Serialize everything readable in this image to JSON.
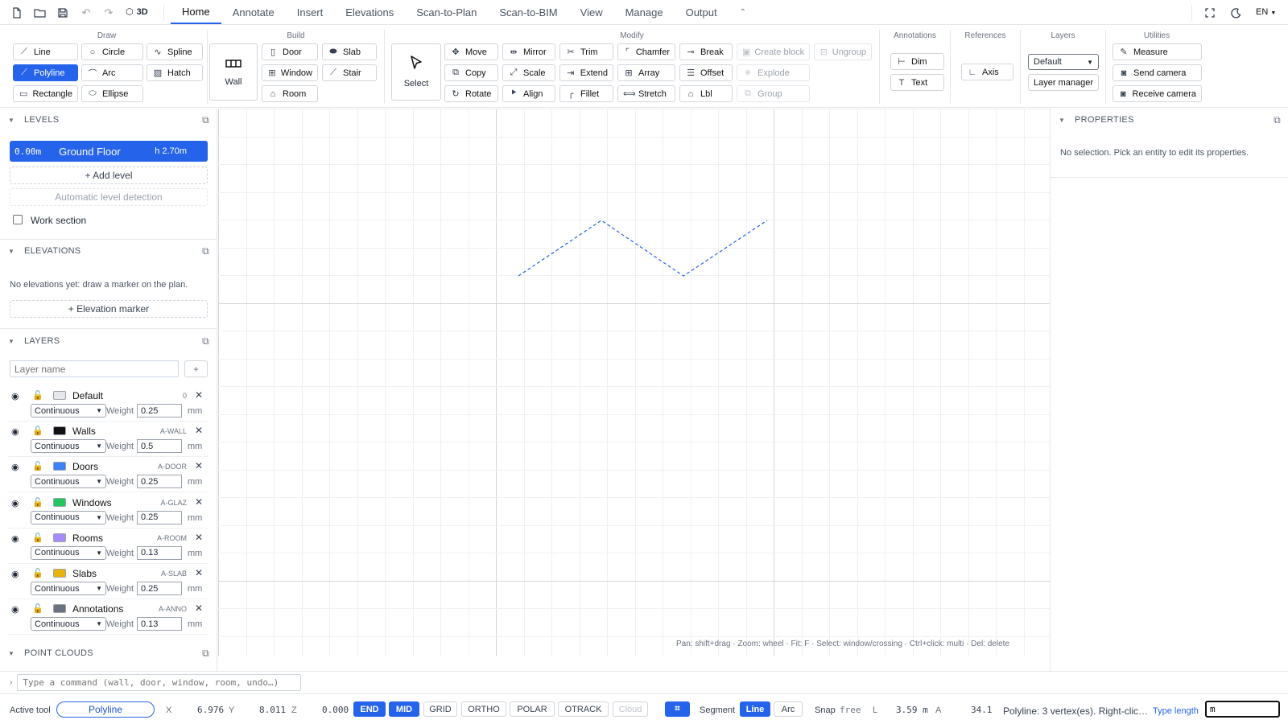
{
  "menubar": {
    "icons": [
      "new-file-icon",
      "open-folder-icon",
      "save-icon",
      "undo-icon",
      "redo-icon"
    ],
    "view3d_label": "3D",
    "tabs": [
      "Home",
      "Annotate",
      "Insert",
      "Elevations",
      "Scan-to-Plan",
      "Scan-to-BIM",
      "View",
      "Manage",
      "Output"
    ],
    "active_tab": "Home",
    "lang": "EN"
  },
  "ribbon": {
    "draw": {
      "title": "Draw",
      "line": "Line",
      "circle": "Circle",
      "spline": "Spline",
      "polyline": "Polyline",
      "arc": "Arc",
      "hatch": "Hatch",
      "rectangle": "Rectangle",
      "ellipse": "Ellipse"
    },
    "build": {
      "title": "Build",
      "wall": "Wall",
      "door": "Door",
      "slab": "Slab",
      "window": "Window",
      "stair": "Stair",
      "room": "Room"
    },
    "modify": {
      "title": "Modify",
      "select": "Select",
      "move": "Move",
      "mirror": "Mirror",
      "trim": "Trim",
      "chamfer": "Chamfer",
      "break": "Break",
      "create_block": "Create block",
      "ungroup": "Ungroup",
      "copy": "Copy",
      "scale": "Scale",
      "extend": "Extend",
      "array": "Array",
      "offset": "Offset",
      "explode": "Explode",
      "rotate": "Rotate",
      "align": "Align",
      "fillet": "Fillet",
      "stretch": "Stretch",
      "lbl": "Lbl",
      "group": "Group"
    },
    "annotations": {
      "title": "Annotations",
      "dim": "Dim",
      "text": "Text"
    },
    "references": {
      "title": "References",
      "axis": "Axis"
    },
    "layers": {
      "title": "Layers",
      "current": "Default",
      "manager": "Layer manager"
    },
    "utilities": {
      "title": "Utilities",
      "measure": "Measure",
      "send_camera": "Send camera",
      "receive_camera": "Receive camera"
    }
  },
  "levels": {
    "header": "LEVELS",
    "items": [
      {
        "elevation": "0.00m",
        "name": "Ground Floor",
        "height": "h 2.70m"
      }
    ],
    "add_level": "+ Add level",
    "auto_detect": "Automatic level detection",
    "work_section": "Work section"
  },
  "elevations": {
    "header": "ELEVATIONS",
    "empty": "No elevations yet: draw a marker on the plan.",
    "add_marker": "+ Elevation marker"
  },
  "layers": {
    "header": "LAYERS",
    "name_placeholder": "Layer name",
    "add": "+",
    "weight_label": "Weight",
    "unit": "mm",
    "items": [
      {
        "name": "Default",
        "code": "0",
        "linetype": "Continuous",
        "weight": "0.25",
        "color": "#e5e7eb"
      },
      {
        "name": "Walls",
        "code": "A-WALL",
        "linetype": "Continuous",
        "weight": "0.5",
        "color": "#111111"
      },
      {
        "name": "Doors",
        "code": "A-DOOR",
        "linetype": "Continuous",
        "weight": "0.25",
        "color": "#3b82f6"
      },
      {
        "name": "Windows",
        "code": "A-GLAZ",
        "linetype": "Continuous",
        "weight": "0.25",
        "color": "#22c55e"
      },
      {
        "name": "Rooms",
        "code": "A-ROOM",
        "linetype": "Continuous",
        "weight": "0.13",
        "color": "#a78bfa"
      },
      {
        "name": "Slabs",
        "code": "A-SLAB",
        "linetype": "Continuous",
        "weight": "0.25",
        "color": "#eab308"
      },
      {
        "name": "Annotations",
        "code": "A-ANNO",
        "linetype": "Continuous",
        "weight": "0.13",
        "color": "#6b7280"
      }
    ]
  },
  "point_clouds": {
    "header": "POINT CLOUDS"
  },
  "properties": {
    "header": "PROPERTIES",
    "empty": "No selection. Pick an entity to edit its properties."
  },
  "canvas": {
    "hint": "Pan: shift+drag · Zoom: wheel · Fit: F · Select: window/crossing · Ctrl+click: multi · Del: delete",
    "line_color": "#2563eb"
  },
  "command": {
    "placeholder": "Type a command (wall, door, window, room, undo…)"
  },
  "status": {
    "active_tool_label": "Active tool",
    "active_tool": "Polyline",
    "x_label": "X",
    "x": "6.976",
    "y_label": "Y",
    "y": "8.011",
    "z_label": "Z",
    "z": "0.000",
    "toggles": [
      {
        "label": "END",
        "on": true
      },
      {
        "label": "MID",
        "on": true
      },
      {
        "label": "GRID",
        "on": false
      },
      {
        "label": "ORTHO",
        "on": false
      },
      {
        "label": "POLAR",
        "on": false
      },
      {
        "label": "OTRACK",
        "on": false
      },
      {
        "label": "Cloud",
        "on": false
      }
    ],
    "segment_label": "Segment",
    "seg_line": "Line",
    "seg_arc": "Arc",
    "snap_label": "Snap",
    "snap_value": "free",
    "l_label": "L",
    "length": "3.59 m",
    "a_label": "A",
    "angle": "34.1",
    "message": "Polyline: 3 vertex(es). Right-clic…",
    "type_length_label": "Type length",
    "type_length_value": "m"
  }
}
